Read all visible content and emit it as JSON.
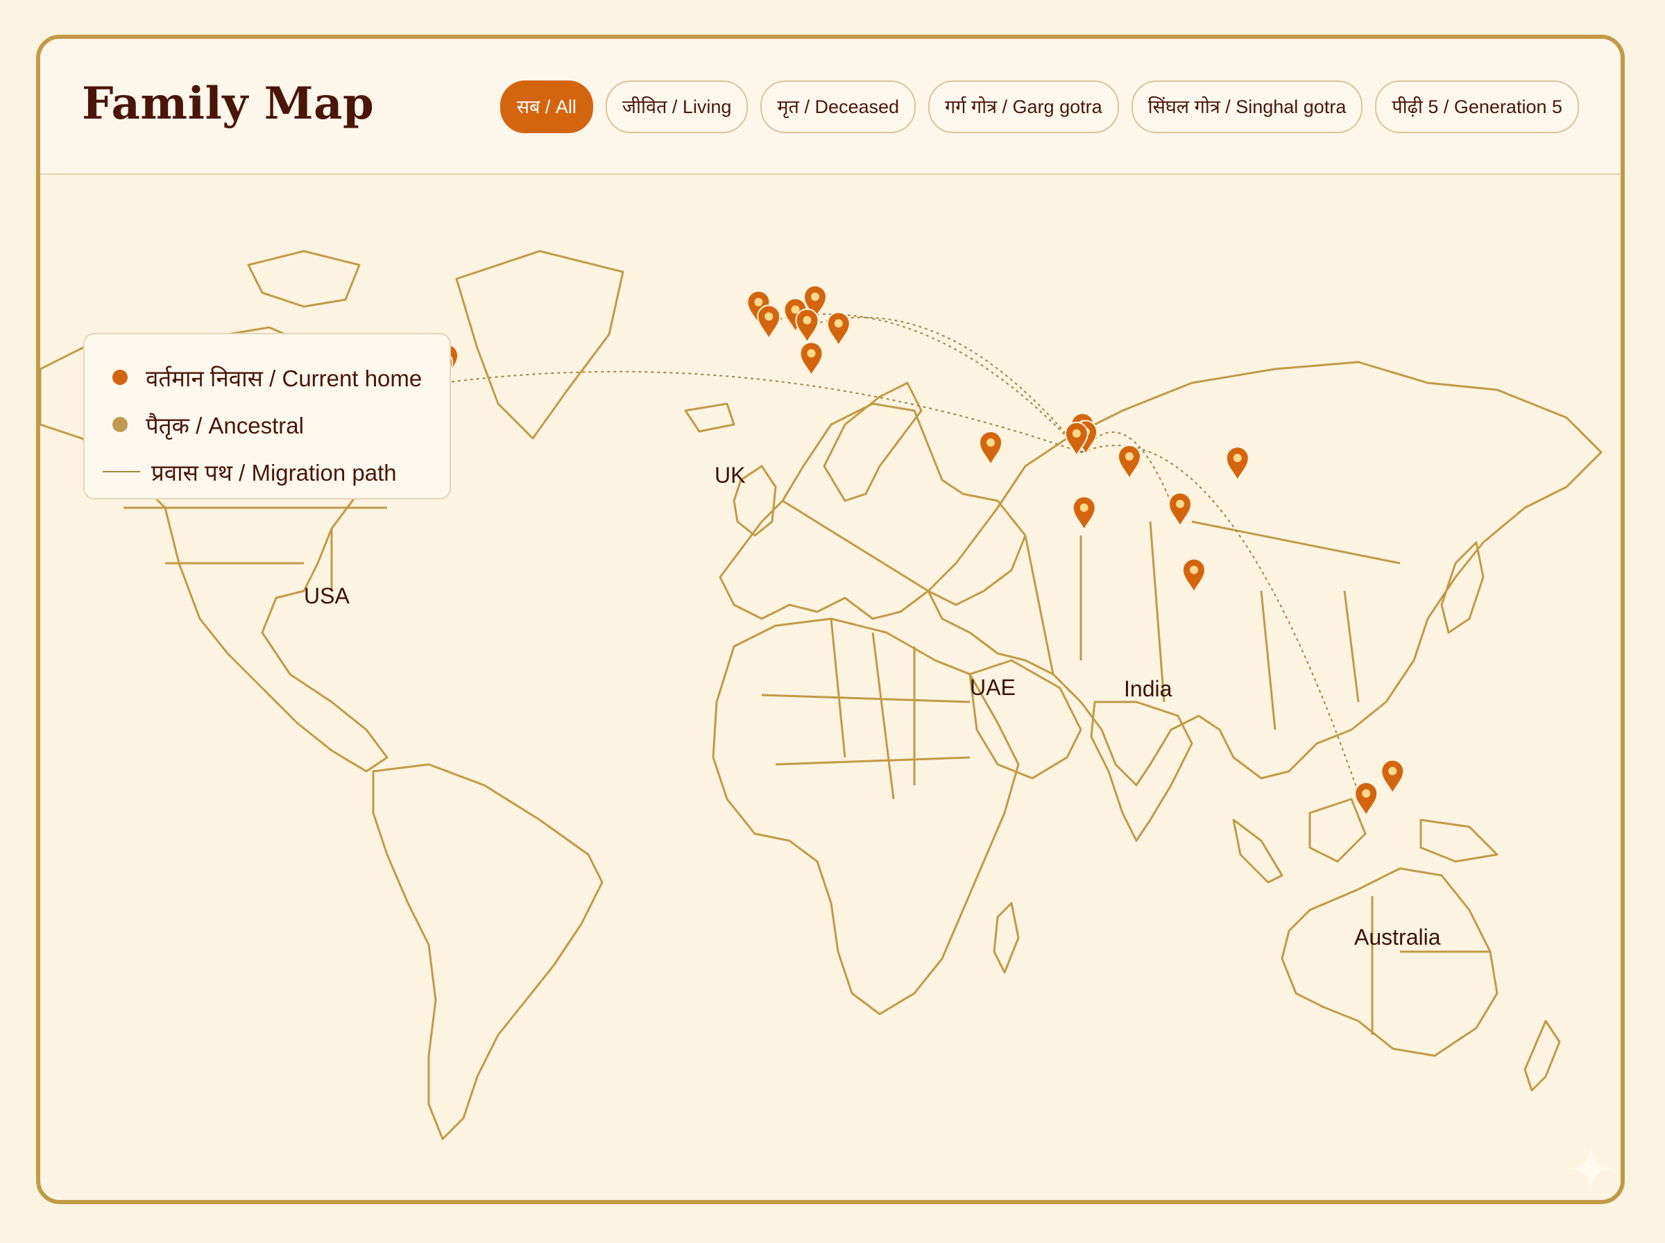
{
  "header": {
    "title": "Family Map"
  },
  "filters": [
    {
      "label": "सब / All",
      "active": true
    },
    {
      "label": "जीवित / Living",
      "active": false
    },
    {
      "label": "मृत / Deceased",
      "active": false
    },
    {
      "label": "गर्ग गोत्र / Garg gotra",
      "active": false
    },
    {
      "label": "सिंघल गोत्र / Singhal gotra",
      "active": false
    },
    {
      "label": "पीढ़ी 5 / Generation 5",
      "active": false
    }
  ],
  "legend": {
    "current_home": "वर्तमान निवास / Current home",
    "ancestral": "पैतृक / Ancestral",
    "migration_path": "प्रवास पथ / Migration path"
  },
  "regions": {
    "usa": "USA",
    "uk": "UK",
    "uae": "UAE",
    "india": "India",
    "australia": "Australia"
  },
  "colors": {
    "accent": "#d4650f",
    "current_home": "#d4650f",
    "ancestral": "#c19a52",
    "land_outline": "#c29a46",
    "background": "#fcf3e1",
    "title": "#4a1608"
  },
  "markers": [
    {
      "lat": 37.7,
      "lon": -122.4,
      "type": "current_home"
    },
    {
      "lat": 34.0,
      "lon": -118.2,
      "type": "current_home"
    },
    {
      "lat": 43.0,
      "lon": -76.0,
      "type": "current_home"
    },
    {
      "lat": 41.5,
      "lon": -74.5,
      "type": "current_home"
    },
    {
      "lat": 40.2,
      "lon": -75.8,
      "type": "current_home"
    },
    {
      "lat": 39.0,
      "lon": -77.0,
      "type": "current_home"
    },
    {
      "lat": 51.5,
      "lon": -0.1,
      "type": "current_home"
    },
    {
      "lat": 48.8,
      "lon": 2.35,
      "type": "current_home"
    },
    {
      "lat": 50.1,
      "lon": 8.7,
      "type": "current_home"
    },
    {
      "lat": 52.5,
      "lon": 13.4,
      "type": "current_home"
    },
    {
      "lat": 48.1,
      "lon": 11.5,
      "type": "current_home"
    },
    {
      "lat": 47.5,
      "lon": 19.0,
      "type": "current_home"
    },
    {
      "lat": 41.9,
      "lon": 12.5,
      "type": "current_home"
    },
    {
      "lat": 25.2,
      "lon": 55.3,
      "type": "current_home"
    },
    {
      "lat": 28.6,
      "lon": 77.2,
      "type": "current_home"
    },
    {
      "lat": 27.2,
      "lon": 78.0,
      "type": "current_home"
    },
    {
      "lat": 26.9,
      "lon": 75.8,
      "type": "current_home"
    },
    {
      "lat": 22.6,
      "lon": 88.4,
      "type": "current_home"
    },
    {
      "lat": 13.0,
      "lon": 77.6,
      "type": "current_home"
    },
    {
      "lat": 13.7,
      "lon": 100.5,
      "type": "current_home"
    },
    {
      "lat": 1.35,
      "lon": 103.8,
      "type": "current_home"
    },
    {
      "lat": 22.3,
      "lon": 114.2,
      "type": "current_home"
    },
    {
      "lat": -37.8,
      "lon": 144.9,
      "type": "current_home"
    },
    {
      "lat": -33.9,
      "lon": 151.2,
      "type": "current_home"
    }
  ],
  "migration_paths": [
    {
      "from": "India",
      "to": "USA"
    },
    {
      "from": "India",
      "to": "UK"
    },
    {
      "from": "India",
      "to": "Germany"
    },
    {
      "from": "India",
      "to": "Australia"
    },
    {
      "from": "India",
      "to": "Southeast Asia"
    }
  ]
}
